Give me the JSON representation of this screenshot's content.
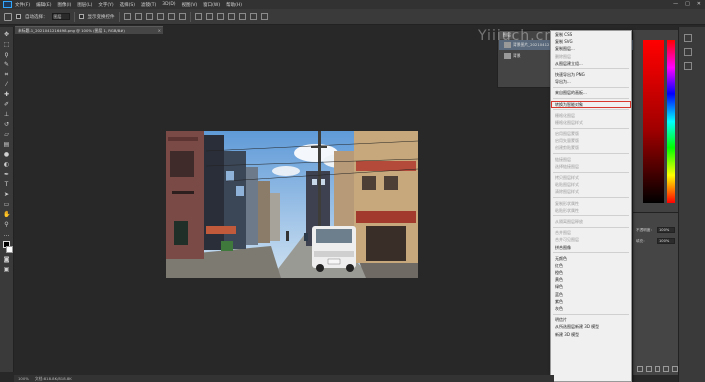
{
  "menubar": {
    "logo": "Ps",
    "items": [
      "文件(F)",
      "编辑(E)",
      "图像(I)",
      "图层(L)",
      "文字(Y)",
      "选择(S)",
      "滤镜(T)",
      "3D(D)",
      "视图(V)",
      "窗口(W)",
      "帮助(H)"
    ],
    "window_controls": [
      "—",
      "□",
      "✕"
    ]
  },
  "options": {
    "auto_select_label": "自动选择：",
    "auto_select_value": "图层",
    "show_transform_label": "显示变换控件"
  },
  "document": {
    "tab_title": "未标题-1_2021041216498.png @ 100% (图层 1, RGB/8#)",
    "close": "×"
  },
  "status": {
    "zoom": "100%",
    "doc_size": "文档:818.8K/818.8K"
  },
  "layers_panel": {
    "tab": "图层",
    "rows": [
      {
        "label": "背景图片_20210412",
        "selected": true
      },
      {
        "label": "背景",
        "selected": false
      }
    ]
  },
  "watermark": "Yiiiuch.cn",
  "properties": {
    "opacity_label": "不透明度：",
    "opacity_value": "100%",
    "fill_label": "填充：",
    "fill_value": "100%"
  },
  "context_menu": {
    "items": [
      {
        "label": "复制 CSS",
        "disabled": false
      },
      {
        "label": "复制 SVG",
        "disabled": false
      },
      {
        "label": "复制图层...",
        "disabled": false
      },
      {
        "label": "删除图层",
        "disabled": true
      },
      {
        "label": "从图层建立组...",
        "disabled": false
      },
      {
        "sep": true
      },
      {
        "label": "快速导出为 PNG",
        "disabled": false
      },
      {
        "label": "导出为...",
        "disabled": false
      },
      {
        "sep": true
      },
      {
        "label": "来自图层的画板...",
        "disabled": false
      },
      {
        "sep": true
      },
      {
        "label": "转换为智能对象",
        "disabled": false,
        "highlight": true
      },
      {
        "sep": true
      },
      {
        "label": "栅格化图层",
        "disabled": true
      },
      {
        "label": "栅格化图层样式",
        "disabled": true
      },
      {
        "sep": true
      },
      {
        "label": "启用图层蒙版",
        "disabled": true
      },
      {
        "label": "启用矢量蒙版",
        "disabled": true
      },
      {
        "label": "创建剪贴蒙版",
        "disabled": true
      },
      {
        "sep": true
      },
      {
        "label": "链接图层",
        "disabled": true
      },
      {
        "label": "选择链接图层",
        "disabled": true
      },
      {
        "sep": true
      },
      {
        "label": "拷贝图层样式",
        "disabled": true
      },
      {
        "label": "粘贴图层样式",
        "disabled": true
      },
      {
        "label": "清除图层样式",
        "disabled": true
      },
      {
        "sep": true
      },
      {
        "label": "复制形状属性",
        "disabled": true
      },
      {
        "label": "粘贴形状属性",
        "disabled": true
      },
      {
        "sep": true
      },
      {
        "label": "从隔离图层释放",
        "disabled": true
      },
      {
        "sep": true
      },
      {
        "label": "合并图层",
        "disabled": true
      },
      {
        "label": "合并可见图层",
        "disabled": true
      },
      {
        "label": "拼合图像",
        "disabled": false
      },
      {
        "sep": true
      },
      {
        "label": "无颜色",
        "disabled": false
      },
      {
        "label": "红色",
        "disabled": false
      },
      {
        "label": "橙色",
        "disabled": false
      },
      {
        "label": "黄色",
        "disabled": false
      },
      {
        "label": "绿色",
        "disabled": false
      },
      {
        "label": "蓝色",
        "disabled": false
      },
      {
        "label": "紫色",
        "disabled": false
      },
      {
        "label": "灰色",
        "disabled": false
      },
      {
        "sep": true
      },
      {
        "label": "明信片",
        "disabled": false
      },
      {
        "label": "从所选图层新建 3D 模型",
        "disabled": false
      },
      {
        "label": "新建 3D 模型",
        "disabled": false
      }
    ]
  },
  "colors": {
    "highlight_outline": "#d9362e",
    "menubar_bg": "#323232",
    "canvas_bg": "#282828"
  }
}
